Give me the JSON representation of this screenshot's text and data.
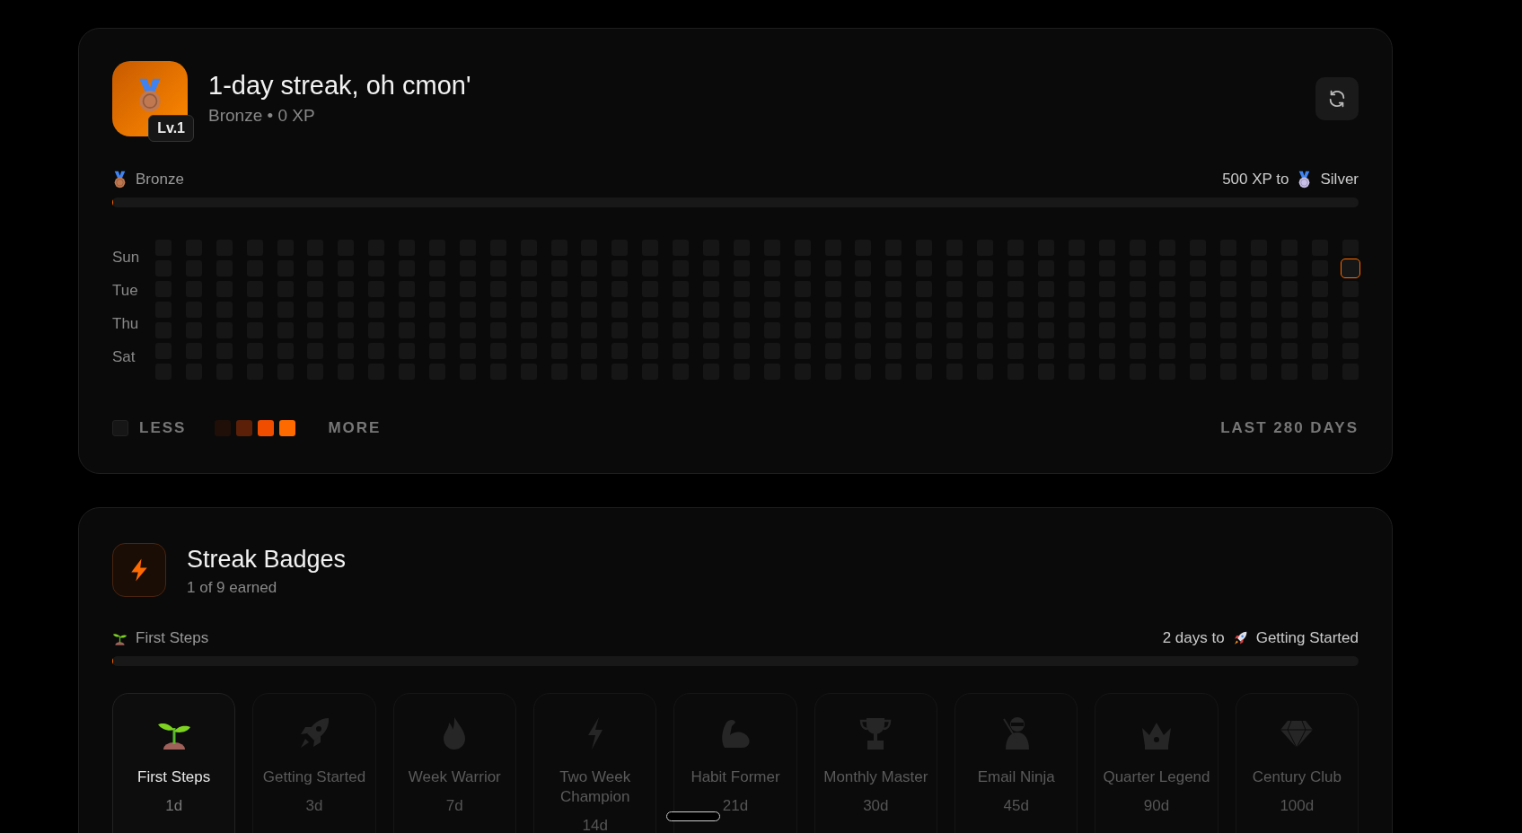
{
  "streak_card": {
    "title": "1-day streak, oh cmon'",
    "level_badge": "Lv.1",
    "subtitle": "Bronze • 0 XP",
    "current_tier": "Bronze",
    "next_tier_prefix": "500 XP to",
    "next_tier": "Silver",
    "xp_progress": {
      "level": 0
    },
    "day_labels": [
      "Sun",
      "Tue",
      "Thu",
      "Sat"
    ],
    "weeks": [
      {
        "today": [
          false,
          false,
          false,
          false,
          false,
          false,
          false
        ]
      },
      {
        "today": [
          false,
          false,
          false,
          false,
          false,
          false,
          false
        ]
      },
      {
        "today": [
          false,
          false,
          false,
          false,
          false,
          false,
          false
        ]
      },
      {
        "today": [
          false,
          false,
          false,
          false,
          false,
          false,
          false
        ]
      },
      {
        "today": [
          false,
          false,
          false,
          false,
          false,
          false,
          false
        ]
      },
      {
        "today": [
          false,
          false,
          false,
          false,
          false,
          false,
          false
        ]
      },
      {
        "today": [
          false,
          false,
          false,
          false,
          false,
          false,
          false
        ]
      },
      {
        "today": [
          false,
          false,
          false,
          false,
          false,
          false,
          false
        ]
      },
      {
        "today": [
          false,
          false,
          false,
          false,
          false,
          false,
          false
        ]
      },
      {
        "today": [
          false,
          false,
          false,
          false,
          false,
          false,
          false
        ]
      },
      {
        "today": [
          false,
          false,
          false,
          false,
          false,
          false,
          false
        ]
      },
      {
        "today": [
          false,
          false,
          false,
          false,
          false,
          false,
          false
        ]
      },
      {
        "today": [
          false,
          false,
          false,
          false,
          false,
          false,
          false
        ]
      },
      {
        "today": [
          false,
          false,
          false,
          false,
          false,
          false,
          false
        ]
      },
      {
        "today": [
          false,
          false,
          false,
          false,
          false,
          false,
          false
        ]
      },
      {
        "today": [
          false,
          false,
          false,
          false,
          false,
          false,
          false
        ]
      },
      {
        "today": [
          false,
          false,
          false,
          false,
          false,
          false,
          false
        ]
      },
      {
        "today": [
          false,
          false,
          false,
          false,
          false,
          false,
          false
        ]
      },
      {
        "today": [
          false,
          false,
          false,
          false,
          false,
          false,
          false
        ]
      },
      {
        "today": [
          false,
          false,
          false,
          false,
          false,
          false,
          false
        ]
      },
      {
        "today": [
          false,
          false,
          false,
          false,
          false,
          false,
          false
        ]
      },
      {
        "today": [
          false,
          false,
          false,
          false,
          false,
          false,
          false
        ]
      },
      {
        "today": [
          false,
          false,
          false,
          false,
          false,
          false,
          false
        ]
      },
      {
        "today": [
          false,
          false,
          false,
          false,
          false,
          false,
          false
        ]
      },
      {
        "today": [
          false,
          false,
          false,
          false,
          false,
          false,
          false
        ]
      },
      {
        "today": [
          false,
          false,
          false,
          false,
          false,
          false,
          false
        ]
      },
      {
        "today": [
          false,
          false,
          false,
          false,
          false,
          false,
          false
        ]
      },
      {
        "today": [
          false,
          false,
          false,
          false,
          false,
          false,
          false
        ]
      },
      {
        "today": [
          false,
          false,
          false,
          false,
          false,
          false,
          false
        ]
      },
      {
        "today": [
          false,
          false,
          false,
          false,
          false,
          false,
          false
        ]
      },
      {
        "today": [
          false,
          false,
          false,
          false,
          false,
          false,
          false
        ]
      },
      {
        "today": [
          false,
          false,
          false,
          false,
          false,
          false,
          false
        ]
      },
      {
        "today": [
          false,
          false,
          false,
          false,
          false,
          false,
          false
        ]
      },
      {
        "today": [
          false,
          false,
          false,
          false,
          false,
          false,
          false
        ]
      },
      {
        "today": [
          false,
          false,
          false,
          false,
          false,
          false,
          false
        ]
      },
      {
        "today": [
          false,
          false,
          false,
          false,
          false,
          false,
          false
        ]
      },
      {
        "today": [
          false,
          false,
          false,
          false,
          false,
          false,
          false
        ]
      },
      {
        "today": [
          false,
          false,
          false,
          false,
          false,
          false,
          false
        ]
      },
      {
        "today": [
          false,
          false,
          false,
          false,
          false,
          false,
          false
        ]
      },
      {
        "today": [
          false,
          true,
          false,
          false,
          false,
          false,
          false
        ]
      }
    ],
    "legend": {
      "less": "LESS",
      "more": "MORE",
      "swatches": [
        {
          "color": "#1f0f08"
        },
        {
          "color": "#5c1f08"
        },
        {
          "color": "#f04d00"
        },
        {
          "color": "#ff6a00"
        }
      ],
      "range": "LAST 280 DAYS"
    }
  },
  "badges_card": {
    "title": "Streak Badges",
    "subtitle": "1 of 9 earned",
    "current": "First Steps",
    "next_prefix": "2 days to",
    "next": "Getting Started",
    "progress": {
      "level": 0
    },
    "badges": [
      {
        "kind": "sprout",
        "name": "First Steps",
        "days": "1d",
        "earned": true
      },
      {
        "kind": "rocket",
        "name": "Getting Started",
        "days": "3d",
        "earned": false
      },
      {
        "kind": "flame",
        "name": "Week Warrior",
        "days": "7d",
        "earned": false
      },
      {
        "kind": "bolt",
        "name": "Two Week Champion",
        "days": "14d",
        "earned": false
      },
      {
        "kind": "arm",
        "name": "Habit Former",
        "days": "21d",
        "earned": false
      },
      {
        "kind": "trophy",
        "name": "Monthly Master",
        "days": "30d",
        "earned": false
      },
      {
        "kind": "ninja",
        "name": "Email Ninja",
        "days": "45d",
        "earned": false
      },
      {
        "kind": "crown",
        "name": "Quarter Legend",
        "days": "90d",
        "earned": false
      },
      {
        "kind": "gem",
        "name": "Century Club",
        "days": "100d",
        "earned": false
      }
    ]
  }
}
